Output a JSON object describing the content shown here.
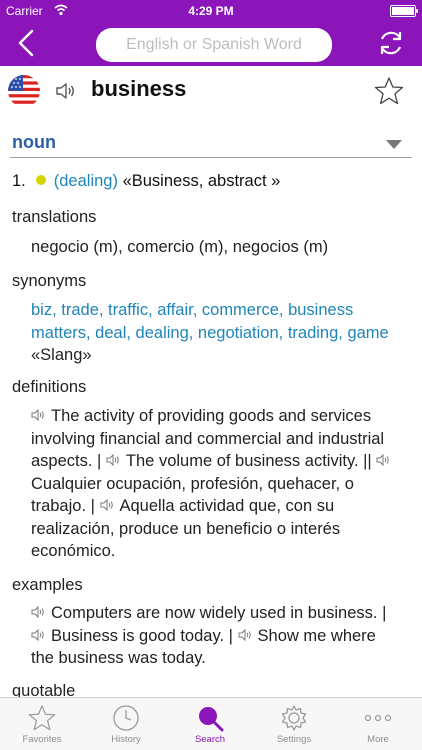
{
  "status": {
    "carrier": "Carrier",
    "time": "4:29 PM"
  },
  "search": {
    "placeholder": "English or Spanish Word"
  },
  "entry": {
    "headword": "business",
    "part_of_speech": "noun",
    "sense_number": "1.",
    "sense_domain": "(dealing)",
    "sense_tags": "«Business, abstract »"
  },
  "sections": {
    "translations_label": "translations",
    "translations_text": "negocio (m), comercio (m), negocios (m)",
    "synonyms_label": "synonyms",
    "synonyms_links": "biz, trade, traffic, affair, commerce, business matters, deal, dealing, negotiation, trading, game",
    "synonyms_tail": "«Slang»",
    "definitions_label": "definitions",
    "definition_1": "The activity of providing goods and services involving financial and commercial and industrial aspects. |",
    "definition_2": "The volume of business activity. ||",
    "definition_3": "Cualquier ocupación, profesión, quehacer, o trabajo. |",
    "definition_4": "Aquella actividad que, con su realización, produce un beneficio o interés económico.",
    "examples_label": "examples",
    "example_1": "Computers are now widely used in business.",
    "example_sep": "|",
    "example_2": "Business is good today.",
    "example_3": "Show me where the business was today.",
    "quotable_label": "quotable"
  },
  "tabs": [
    {
      "label": "Favorites"
    },
    {
      "label": "History"
    },
    {
      "label": "Search"
    },
    {
      "label": "Settings"
    },
    {
      "label": "More"
    }
  ],
  "colors": {
    "accent": "#8b15b9",
    "link": "#1f85b9",
    "example": "#6b2b8c",
    "dot": "#d8d400"
  }
}
